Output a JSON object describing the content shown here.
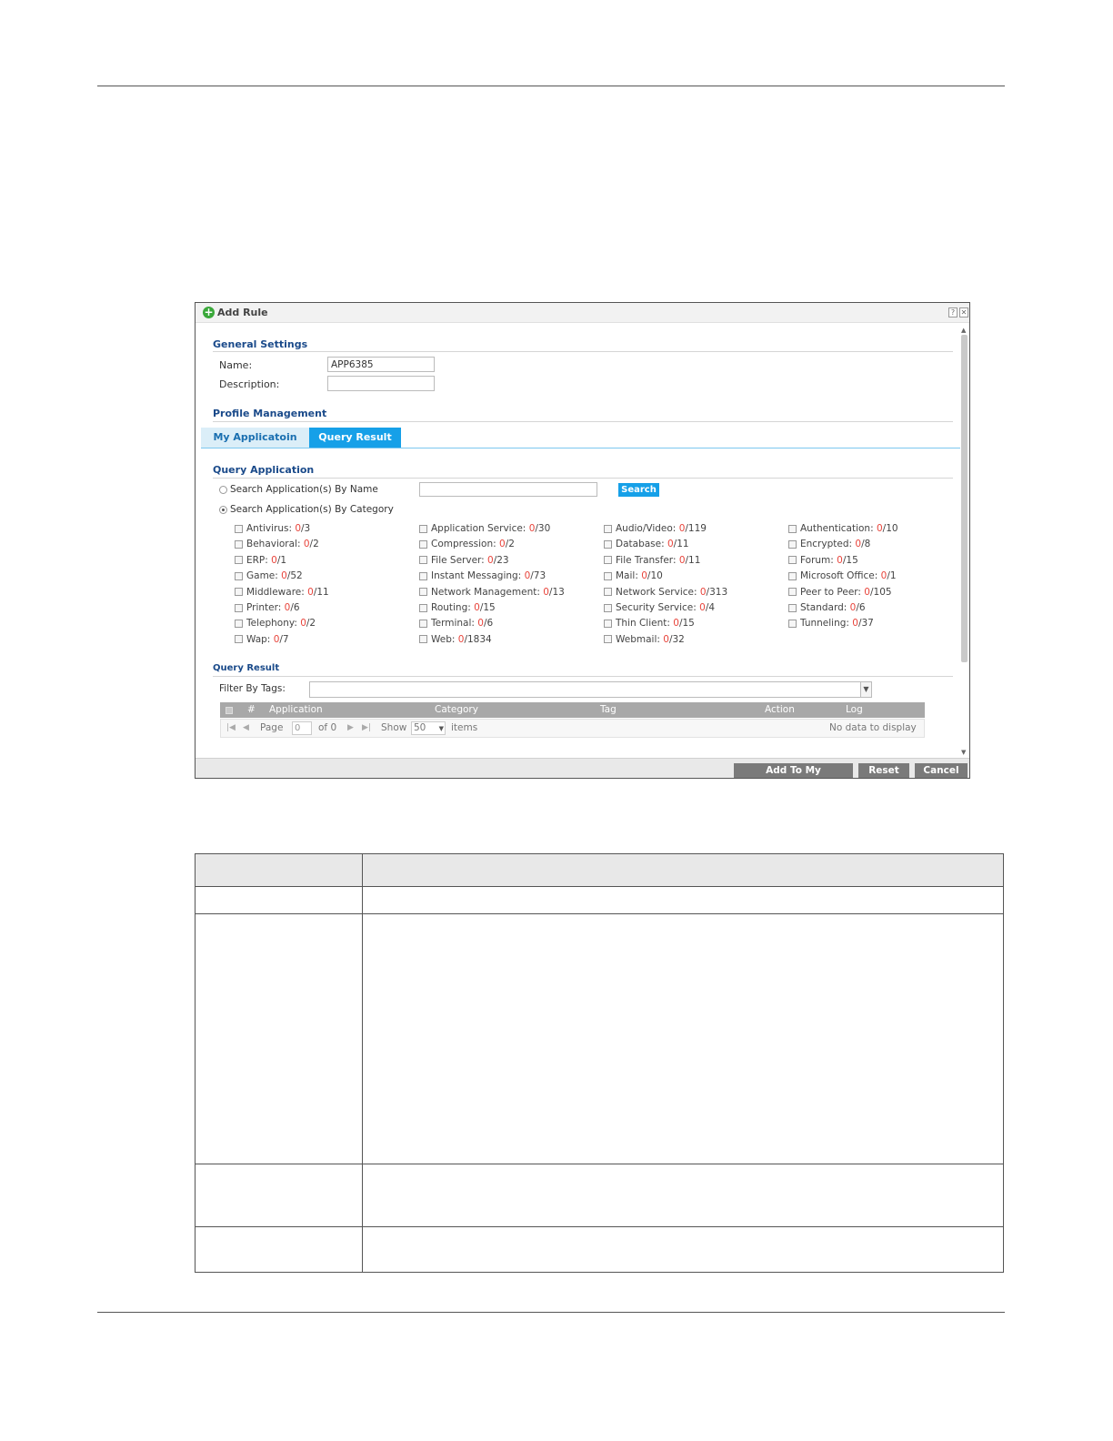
{
  "dialog": {
    "title": "Add Rule",
    "help_icon": "question-icon",
    "close_icon": "close-icon",
    "general": {
      "heading": "General Settings",
      "name_label": "Name:",
      "name_value": "APP6385",
      "description_label": "Description:",
      "description_value": ""
    },
    "profile": {
      "heading": "Profile Management",
      "tab_my": "My Applicatoin",
      "tab_query": "Query Result"
    },
    "query": {
      "heading": "Query Application",
      "by_name_label": "Search Application(s) By Name",
      "by_name_value": "",
      "search_button": "Search",
      "by_category_label": "Search Application(s) By Category",
      "selected_mode": "category",
      "categories": [
        {
          "label": "Antivirus: ",
          "count": "0",
          "total": "/3"
        },
        {
          "label": "Application Service: ",
          "count": "0",
          "total": "/30"
        },
        {
          "label": "Audio/Video: ",
          "count": "0",
          "total": "/119"
        },
        {
          "label": "Authentication: ",
          "count": "0",
          "total": "/10"
        },
        {
          "label": "Behavioral: ",
          "count": "0",
          "total": "/2"
        },
        {
          "label": "Compression: ",
          "count": "0",
          "total": "/2"
        },
        {
          "label": "Database: ",
          "count": "0",
          "total": "/11"
        },
        {
          "label": "Encrypted: ",
          "count": "0",
          "total": "/8"
        },
        {
          "label": "ERP: ",
          "count": "0",
          "total": "/1"
        },
        {
          "label": "File Server: ",
          "count": "0",
          "total": "/23"
        },
        {
          "label": "File Transfer: ",
          "count": "0",
          "total": "/11"
        },
        {
          "label": "Forum: ",
          "count": "0",
          "total": "/15"
        },
        {
          "label": "Game: ",
          "count": "0",
          "total": "/52"
        },
        {
          "label": "Instant Messaging: ",
          "count": "0",
          "total": "/73"
        },
        {
          "label": "Mail: ",
          "count": "0",
          "total": "/10"
        },
        {
          "label": "Microsoft Office: ",
          "count": "0",
          "total": "/1"
        },
        {
          "label": "Middleware: ",
          "count": "0",
          "total": "/11"
        },
        {
          "label": "Network Management: ",
          "count": "0",
          "total": "/13"
        },
        {
          "label": "Network Service: ",
          "count": "0",
          "total": "/313"
        },
        {
          "label": "Peer to Peer: ",
          "count": "0",
          "total": "/105"
        },
        {
          "label": "Printer: ",
          "count": "0",
          "total": "/6"
        },
        {
          "label": "Routing: ",
          "count": "0",
          "total": "/15"
        },
        {
          "label": "Security Service: ",
          "count": "0",
          "total": "/4"
        },
        {
          "label": "Standard: ",
          "count": "0",
          "total": "/6"
        },
        {
          "label": "Telephony: ",
          "count": "0",
          "total": "/2"
        },
        {
          "label": "Terminal: ",
          "count": "0",
          "total": "/6"
        },
        {
          "label": "Thin Client: ",
          "count": "0",
          "total": "/15"
        },
        {
          "label": "Tunneling: ",
          "count": "0",
          "total": "/37"
        },
        {
          "label": "Wap: ",
          "count": "0",
          "total": "/7"
        },
        {
          "label": "Web: ",
          "count": "0",
          "total": "/1834"
        },
        {
          "label": "Webmail: ",
          "count": "0",
          "total": "/32"
        }
      ]
    },
    "result": {
      "heading": "Query Result",
      "filter_label": "Filter By Tags:",
      "filter_value": "",
      "columns": [
        "#",
        "Application",
        "Category",
        "Tag",
        "Action",
        "Log"
      ],
      "pager": {
        "page_label": "Page",
        "page_value": "0",
        "of_label": "of 0",
        "show_label": "Show",
        "show_value": "50",
        "items_label": "items",
        "empty_text": "No data to display"
      }
    },
    "buttons": {
      "add": "Add To My Application",
      "reset": "Reset",
      "cancel": "Cancel"
    },
    "colors": {
      "accent": "#16a0e8",
      "count": "#e8453c",
      "heading": "#1a4a8a"
    }
  }
}
